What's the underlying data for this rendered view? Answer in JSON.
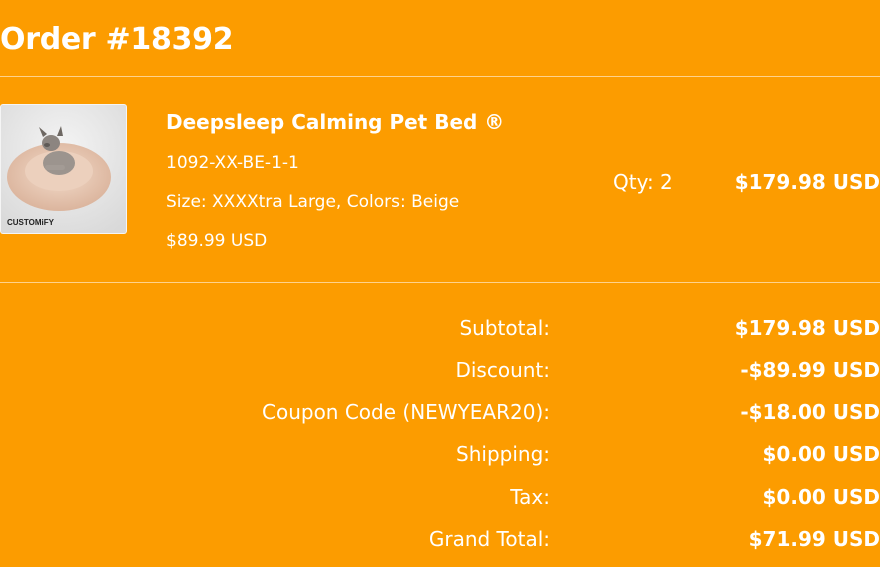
{
  "order": {
    "title": "Order #18392"
  },
  "item": {
    "image_alt": "pet bed product photo",
    "image_brand": "CUSTOMiFY",
    "name": "Deepsleep Calming Pet Bed ®",
    "sku": "1092-XX-BE-1-1",
    "variant": "Size: XXXXtra Large, Colors: Beige",
    "unit_price": "$89.99 USD",
    "quantity_label": "Qty: 2",
    "line_total": "$179.98 USD"
  },
  "summary": [
    {
      "label": "Subtotal:",
      "value": "$179.98 USD"
    },
    {
      "label": "Discount:",
      "value": "-$89.99 USD"
    },
    {
      "label": "Coupon Code (NEWYEAR20):",
      "value": "-$18.00 USD"
    },
    {
      "label": "Shipping:",
      "value": "$0.00 USD"
    },
    {
      "label": "Tax:",
      "value": "$0.00 USD"
    },
    {
      "label": "Grand Total:",
      "value": "$71.99 USD"
    }
  ],
  "colors": {
    "background": "#fc9c00",
    "text": "#ffffff"
  }
}
